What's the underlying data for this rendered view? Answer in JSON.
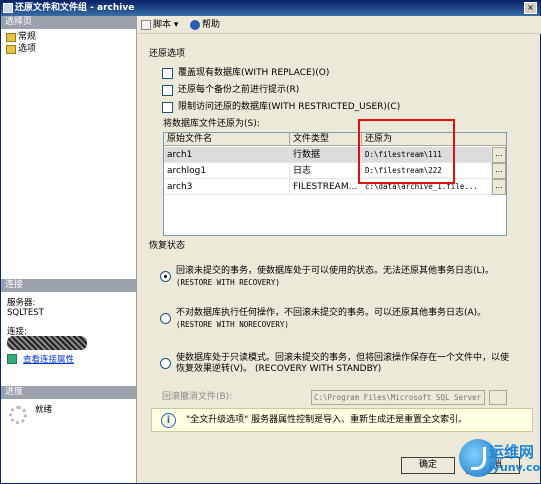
{
  "window": {
    "title": "还原文件和文件组 - archive",
    "close_glyph": "×"
  },
  "left": {
    "select_page_header": "选择页",
    "pages": [
      {
        "label": "常规"
      },
      {
        "label": "选项"
      }
    ],
    "connection_header": "连接",
    "server_label": "服务器:",
    "server_value": "SQLTEST",
    "connection_label": "连接:",
    "view_conn_props": "查看连接属性",
    "progress_header": "进度",
    "progress_status": "就绪"
  },
  "toolbar": {
    "script_label": "脚本",
    "script_dropdown": "▾",
    "help_label": "帮助"
  },
  "restore_options": {
    "title": "还原选项",
    "options": [
      {
        "label": "覆盖现有数据库(WITH REPLACE)(O)",
        "checked": false
      },
      {
        "label": "还原每个备份之前进行提示(R)",
        "checked": false
      },
      {
        "label": "限制访问还原的数据库(WITH RESTRICTED_USER)(C)",
        "checked": false
      }
    ]
  },
  "file_grid": {
    "label": "将数据库文件还原为(S):",
    "columns": [
      "原始文件名",
      "文件类型",
      "还原为"
    ],
    "rows": [
      {
        "name": "arch1",
        "type": "行数据",
        "restore_as": "D:\\filestream\\111"
      },
      {
        "name": "archlog1",
        "type": "日志",
        "restore_as": "D:\\filestream\\222"
      },
      {
        "name": "arch3",
        "type": "FILESTREAM...",
        "restore_as": "c:\\data\\archive_1.file..."
      }
    ],
    "browse_glyph": "..."
  },
  "recovery_state": {
    "title": "恢复状态",
    "options": [
      {
        "line1": "回滚未提交的事务，使数据库处于可以使用的状态。无法还原其他事务日志(L)。",
        "line2": "(RESTORE WITH RECOVERY)",
        "selected": true
      },
      {
        "line1": "不对数据库执行任何操作，不回滚未提交的事务。可以还原其他事务日志(A)。",
        "line2": "(RESTORE WITH NORECOVERY)",
        "selected": false
      },
      {
        "line1": "使数据库处于只读模式。回滚未提交的事务，但将回滚操作保存在一个文件中，以使",
        "line2": "恢复效果逆转(V)。 (RECOVERY WITH STANDBY)",
        "selected": false
      }
    ],
    "rollback_file_label": "回滚撤消文件(B):",
    "rollback_file_value": "C:\\Program Files\\Microsoft SQL Server"
  },
  "info": {
    "icon_glyph": "i",
    "text": "\"全文升级选项\" 服务器属性控制是导入、重新生成还是重置全文索引。"
  },
  "buttons": {
    "ok": "确定",
    "cancel": "取消"
  },
  "watermark": {
    "text1": "运维网",
    "text2": "iyunv.com"
  }
}
